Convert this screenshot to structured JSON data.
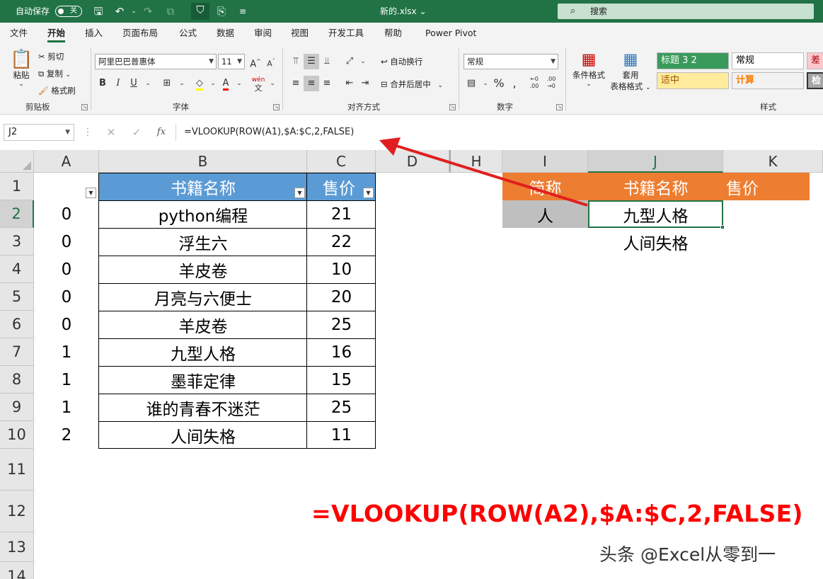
{
  "titlebar": {
    "autosave_label": "自动保存",
    "autosave_state": "关",
    "filename": "新的.xlsx",
    "filename_dropdown": "⌄",
    "search_placeholder": "搜索"
  },
  "tabs": [
    "文件",
    "开始",
    "插入",
    "页面布局",
    "公式",
    "数据",
    "审阅",
    "视图",
    "开发工具",
    "帮助",
    "Power Pivot"
  ],
  "ribbon": {
    "clipboard": {
      "paste": "粘贴",
      "cut": "剪切",
      "copy": "复制",
      "format_painter": "格式刷",
      "group_label": "剪贴板"
    },
    "font": {
      "font_name": "阿里巴巴普惠体",
      "font_size": "11",
      "bold": "B",
      "italic": "I",
      "underline": "U",
      "group_label": "字体",
      "phonetic": "wén"
    },
    "alignment": {
      "wrap_text": "自动换行",
      "merge_center": "合并后居中",
      "group_label": "对齐方式"
    },
    "number": {
      "format": "常规",
      "group_label": "数字"
    },
    "styles_group": {
      "conditional_format": "条件格式",
      "table_format_1": "套用",
      "table_format_2": "表格格式",
      "cells": [
        {
          "label": "标题 3 2",
          "bg": "#3a9a5c",
          "fg": "#ffffff"
        },
        {
          "label": "常规",
          "bg": "#ffffff",
          "fg": "#000000"
        },
        {
          "label": "差",
          "bg": "#ffc7ce",
          "fg": "#9c0006"
        },
        {
          "label": "适中",
          "bg": "#ffeb9c",
          "fg": "#9c5700"
        },
        {
          "label": "计算",
          "bg": "#f2f2f2",
          "fg": "#fa7d00"
        },
        {
          "label": "检",
          "bg": "#a5a5a5",
          "fg": "#ffffff"
        }
      ],
      "group_label": "样式"
    }
  },
  "formula_bar": {
    "name_box": "J2",
    "cancel": "✕",
    "enter": "✓",
    "fx": "fx",
    "formula": "=VLOOKUP(ROW(A1),$A:$C,2,FALSE)"
  },
  "grid": {
    "columns": [
      "A",
      "B",
      "C",
      "D",
      "H",
      "I",
      "J",
      "K"
    ],
    "rows": [
      "1",
      "2",
      "3",
      "4",
      "5",
      "6",
      "7",
      "8",
      "9",
      "10",
      "11",
      "12",
      "13",
      "14"
    ],
    "selected_cell": "J2",
    "table1": {
      "headers": [
        "书籍名称",
        "售价"
      ],
      "rows": [
        {
          "a": "0",
          "b": "python编程",
          "c": "21"
        },
        {
          "a": "0",
          "b": "浮生六",
          "c": "22"
        },
        {
          "a": "0",
          "b": "羊皮卷",
          "c": "10"
        },
        {
          "a": "0",
          "b": "月亮与六便士",
          "c": "20"
        },
        {
          "a": "0",
          "b": "羊皮卷",
          "c": "25"
        },
        {
          "a": "1",
          "b": "九型人格",
          "c": "16"
        },
        {
          "a": "1",
          "b": "墨菲定律",
          "c": "15"
        },
        {
          "a": "1",
          "b": "谁的青春不迷茫",
          "c": "25"
        },
        {
          "a": "2",
          "b": "人间失格",
          "c": "11"
        }
      ]
    },
    "table2": {
      "headers": [
        "简称",
        "书籍名称",
        "售价"
      ],
      "i2": "人",
      "j2": "九型人格",
      "j3": "人间失格"
    }
  },
  "annotation": {
    "big_formula": "=VLOOKUP(ROW(A2),$A:$C,2,FALSE)",
    "watermark": "头条 @Excel从零到一",
    "arrow_color": "#e02020"
  }
}
